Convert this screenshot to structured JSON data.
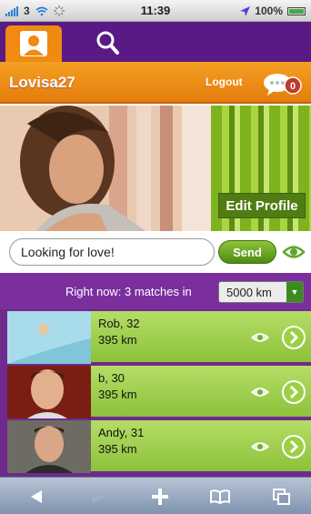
{
  "status_bar": {
    "carrier": "3",
    "time": "11:39",
    "battery": "100%"
  },
  "tabs": [
    {
      "name": "profile",
      "icon": "person-icon",
      "active": true
    },
    {
      "name": "search",
      "icon": "search-icon",
      "active": false
    }
  ],
  "header": {
    "username": "Lovisa27",
    "logout_label": "Logout",
    "message_count": "0"
  },
  "profile": {
    "edit_label": "Edit Profile"
  },
  "status_input": {
    "value": "Looking for love!",
    "send_label": "Send"
  },
  "matches": {
    "summary": "Right now: 3 matches in",
    "distance_value": "5000 km"
  },
  "match_list": [
    {
      "name": "Rob, 32",
      "distance": "395 km"
    },
    {
      "name": "b, 30",
      "distance": "395 km"
    },
    {
      "name": "Andy, 31",
      "distance": "395 km"
    }
  ],
  "colors": {
    "purple": "#5a1a86",
    "orange": "#f08a10",
    "green": "#8cc23a"
  }
}
